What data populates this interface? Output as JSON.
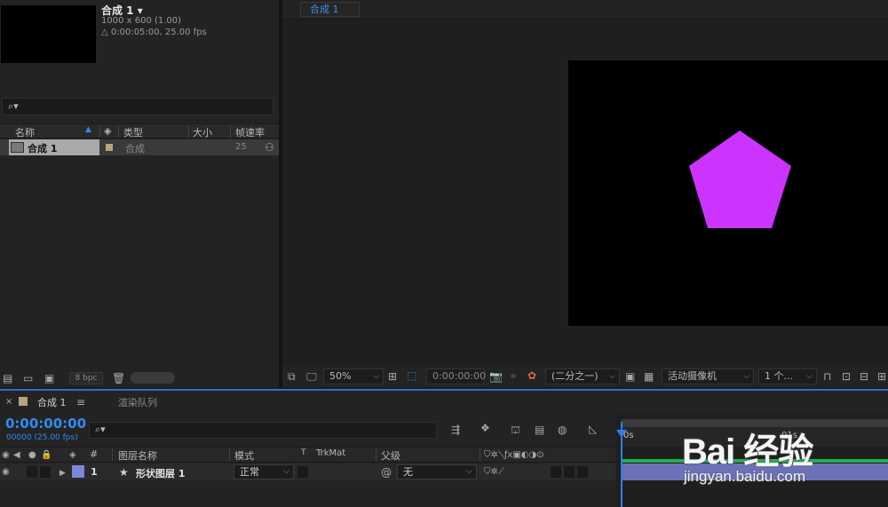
{
  "project": {
    "comp_name": "合成 1 ▾",
    "comp_dims": "1000 x 600 (1.00)",
    "comp_duration": "△ 0:00:05:00, 25.00 fps",
    "search_icon": "⌕▾",
    "columns": {
      "name": "名称",
      "type": "类型",
      "size": "大小",
      "fps": "帧速率"
    },
    "row": {
      "name": "合成 1",
      "type": "合成",
      "fps": "25"
    },
    "bpc": "8 bpc"
  },
  "viewer": {
    "tab": "合成 1",
    "zoom": "50%",
    "timecode": "0:00:00:00",
    "resolution": "(二分之一)",
    "camera": "活动摄像机",
    "views": "1 个..."
  },
  "timeline": {
    "tab": "合成 1",
    "render_queue": "渲染队列",
    "timecode": "0:00:00:00",
    "fps_sub": "00000 (25.00 fps)",
    "columns": {
      "hash": "#",
      "layer_name": "图层名称",
      "mode": "模式",
      "t": "T",
      "trkmat": "TrkMat",
      "parent": "父级"
    },
    "layer": {
      "num": "1",
      "name": "形状图层 1",
      "mode": "正常",
      "parent": "无"
    },
    "ticks": [
      "0s",
      "01s"
    ]
  },
  "watermark": {
    "logo": "Bai 经验",
    "url": "jingyan.baidu.com"
  },
  "colors": {
    "accent": "#2f8bf0",
    "shape": "#cc33ff",
    "layer_label": "#7b86dd",
    "green_bar": "#22b14c"
  },
  "icons": [
    "search-icon",
    "eye-icon",
    "audio-icon",
    "solo-icon",
    "lock-icon",
    "label-icon",
    "trash-icon",
    "folder-icon",
    "camera-icon",
    "hamburger-icon"
  ]
}
